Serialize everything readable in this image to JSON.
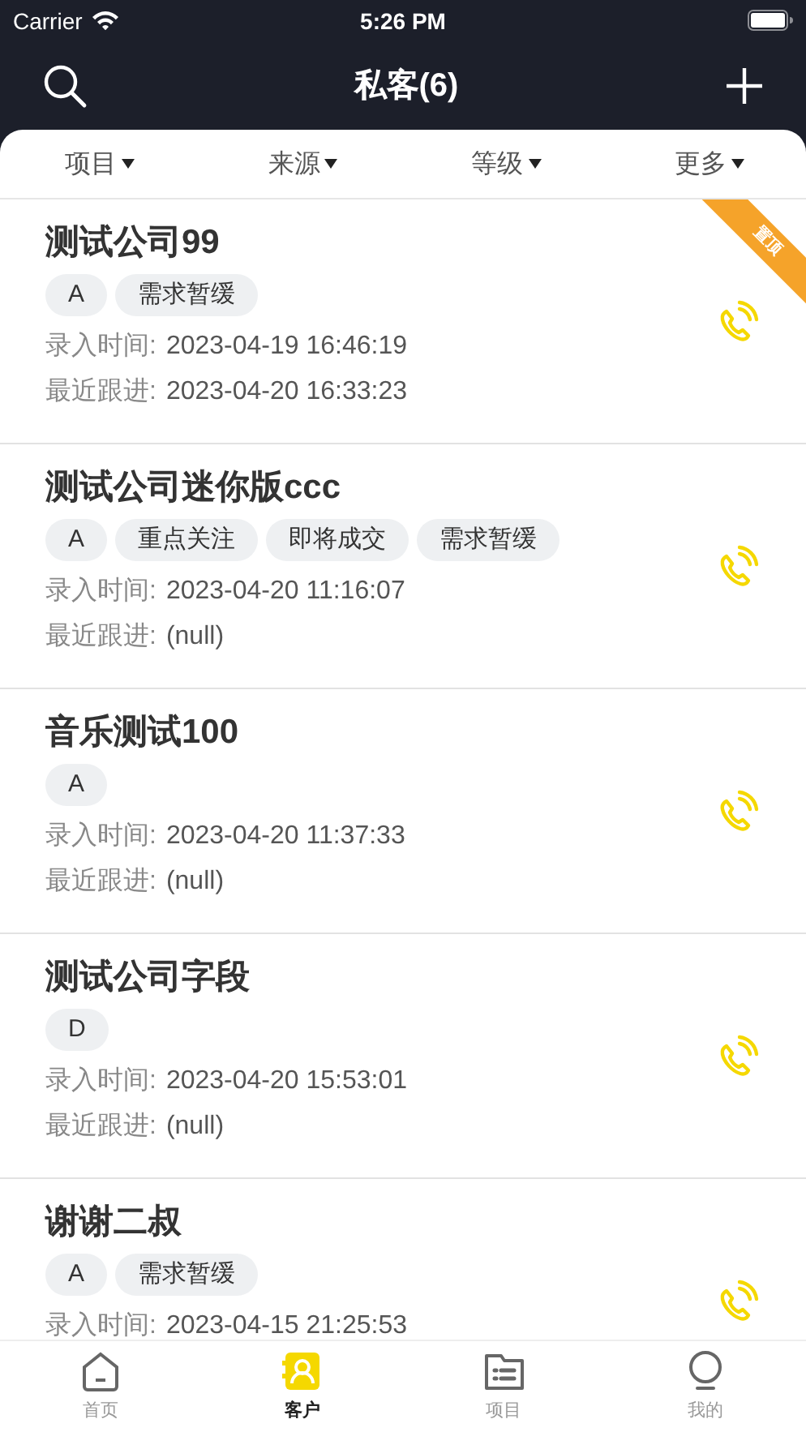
{
  "status_bar": {
    "carrier": "Carrier",
    "time": "5:26 PM"
  },
  "nav": {
    "title": "私客(6)"
  },
  "filters": [
    {
      "label": "项目"
    },
    {
      "label": "来源"
    },
    {
      "label": "等级"
    },
    {
      "label": "更多"
    }
  ],
  "clients": [
    {
      "name": "测试公司99",
      "pinned": true,
      "ribbon": "置顶",
      "tags": [
        "A",
        "需求暂缓"
      ],
      "entry_label": "录入时间:",
      "entry_time": "2023-04-19 16:46:19",
      "follow_label": "最近跟进:",
      "follow_time": "2023-04-20 16:33:23"
    },
    {
      "name": "测试公司迷你版ccc",
      "pinned": false,
      "tags": [
        "A",
        "重点关注",
        "即将成交",
        "需求暂缓"
      ],
      "entry_label": "录入时间:",
      "entry_time": "2023-04-20 11:16:07",
      "follow_label": "最近跟进:",
      "follow_time": "(null)"
    },
    {
      "name": "音乐测试100",
      "pinned": false,
      "tags": [
        "A"
      ],
      "entry_label": "录入时间:",
      "entry_time": "2023-04-20 11:37:33",
      "follow_label": "最近跟进:",
      "follow_time": "(null)"
    },
    {
      "name": "测试公司字段",
      "pinned": false,
      "tags": [
        "D"
      ],
      "entry_label": "录入时间:",
      "entry_time": "2023-04-20 15:53:01",
      "follow_label": "最近跟进:",
      "follow_time": "(null)"
    },
    {
      "name": "谢谢二叔",
      "pinned": false,
      "tags": [
        "A",
        "需求暂缓"
      ],
      "entry_label": "录入时间:",
      "entry_time": "2023-04-15 21:25:53"
    }
  ],
  "tab_bar": [
    {
      "label": "首页",
      "kind": "home",
      "selected": false
    },
    {
      "label": "客户",
      "kind": "contacts",
      "selected": true
    },
    {
      "label": "项目",
      "kind": "folder",
      "selected": false
    },
    {
      "label": "我的",
      "kind": "profile",
      "selected": false
    }
  ]
}
